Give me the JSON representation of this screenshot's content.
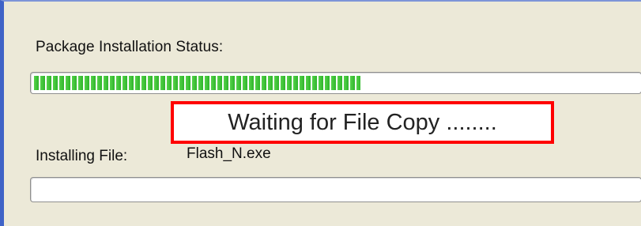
{
  "installer": {
    "status_label": "Package Installation Status:",
    "package_progress": 0.54,
    "waiting_message": "Waiting for File Copy ........",
    "installing_file_label": "Installing File:",
    "installing_file_name": "Flash_N.exe",
    "file_progress": 0
  },
  "colors": {
    "background": "#ece9d8",
    "progress_green": "#2fb52b",
    "highlight_red": "#ff0000",
    "frame_blue": "#3f63c7"
  }
}
